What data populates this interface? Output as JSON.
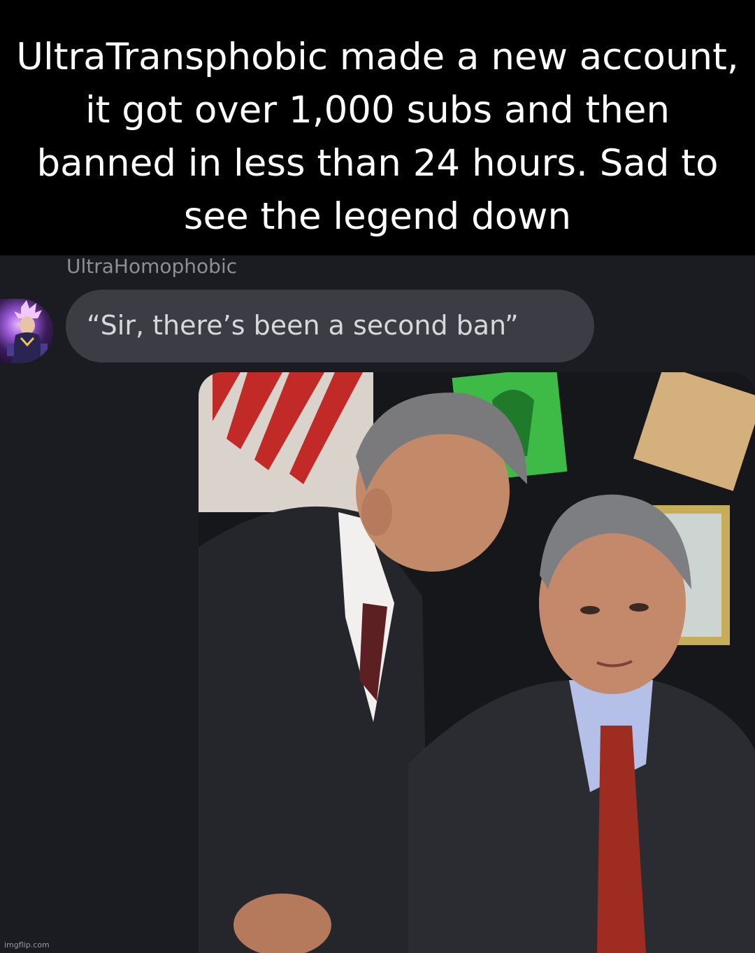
{
  "caption": {
    "text": "UltraTransphobic made a new account, it got over 1,000 subs and then banned in less than 24 hours. Sad to see the legend down"
  },
  "message": {
    "username": "UltraHomophobic",
    "text": "“Sir, there’s been a second ban”",
    "avatar_icon": "anime-character-avatar"
  },
  "photo": {
    "subject": "news-photo"
  },
  "watermark": {
    "text": "imgflip.com"
  },
  "colors": {
    "caption_bg": "#000000",
    "chat_bg": "#1b1c22",
    "bubble_bg": "#3b3c44",
    "username_text": "#8e8e94",
    "bubble_text": "#d8d8dc"
  }
}
